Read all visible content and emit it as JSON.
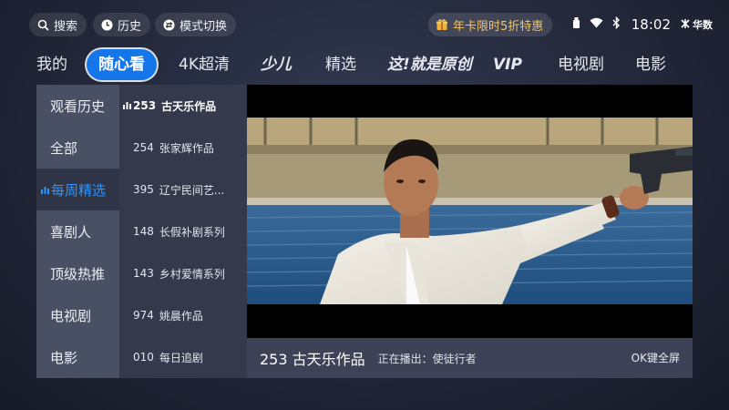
{
  "topbar": {
    "search_label": "搜索",
    "history_label": "历史",
    "mode_label": "模式切换",
    "promo_text": "年卡限时5折特惠",
    "time": "18:02",
    "brand": "华数"
  },
  "tabs": [
    {
      "label": "我的"
    },
    {
      "label": "随心看"
    },
    {
      "label": "4K超清"
    },
    {
      "label": "少儿"
    },
    {
      "label": "精选"
    },
    {
      "label": "这!就是原创"
    },
    {
      "label": "VIP"
    },
    {
      "label": "电视剧"
    },
    {
      "label": "电影"
    }
  ],
  "categories": [
    {
      "label": "观看历史"
    },
    {
      "label": "全部"
    },
    {
      "label": "每周精选"
    },
    {
      "label": "喜剧人"
    },
    {
      "label": "顶级热推"
    },
    {
      "label": "电视剧"
    },
    {
      "label": "电影"
    }
  ],
  "channels": [
    {
      "num": "253",
      "name": "古天乐作品"
    },
    {
      "num": "254",
      "name": "张家辉作品"
    },
    {
      "num": "395",
      "name": "辽宁民间艺..."
    },
    {
      "num": "148",
      "name": "长假补剧系列"
    },
    {
      "num": "143",
      "name": "乡村爱情系列"
    },
    {
      "num": "974",
      "name": "姚晨作品"
    },
    {
      "num": "010",
      "name": "每日追剧"
    }
  ],
  "player": {
    "channel_title": "253 古天乐作品",
    "now_playing": "正在播出：使徒行者",
    "ok_hint": "OK键全屏"
  },
  "colors": {
    "accent": "#1476e8",
    "highlight_text": "#2f95ff",
    "promo": "#f2c56b"
  }
}
